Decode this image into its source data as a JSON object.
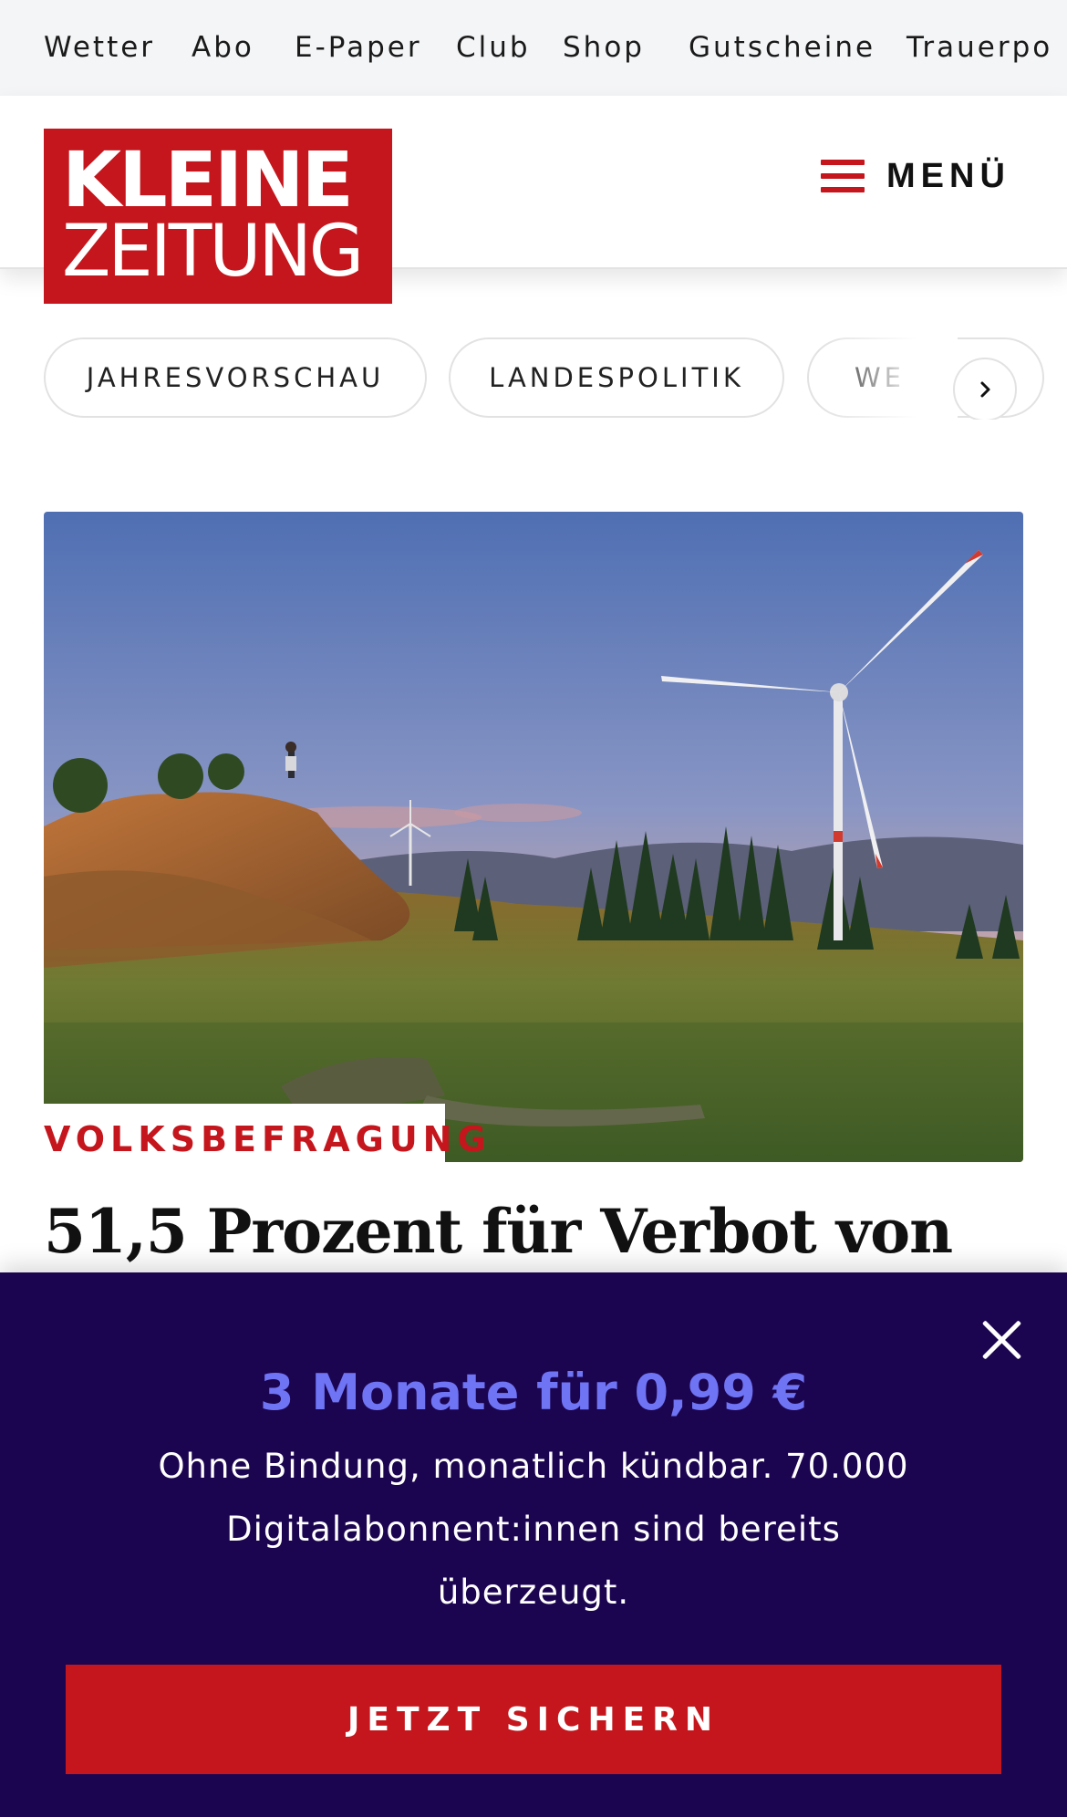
{
  "topnav": {
    "items": [
      "Wetter",
      "Abo",
      "E-Paper",
      "Club",
      "Shop",
      "Gutscheine",
      "Trauerpo"
    ]
  },
  "header": {
    "logo_line1": "KLEINE",
    "logo_line2": "ZEITUNG",
    "menu_label": "MENÜ"
  },
  "chips": {
    "items": [
      "JAHRESVORSCHAU",
      "LANDESPOLITIK",
      "WE"
    ]
  },
  "article": {
    "kicker": "VOLKSBEFRAGUNG",
    "headline": "51,5 Prozent für Verbot von"
  },
  "promo": {
    "title": "3 Monate für 0,99 €",
    "text": "Ohne Bindung, monatlich kündbar. 70.000 Digitalabonnent:innen sind bereits überzeugt.",
    "cta_label": "JETZT SICHERN"
  },
  "colors": {
    "brand_red": "#c4161c",
    "promo_bg": "#1c0550",
    "promo_accent": "#6f74f5"
  },
  "icons": {
    "menu": "hamburger-icon",
    "chips_next": "chevron-right-icon",
    "promo_close": "close-icon"
  }
}
